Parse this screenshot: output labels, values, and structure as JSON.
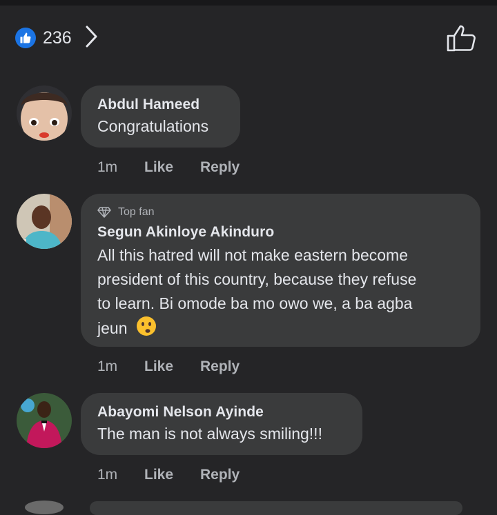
{
  "reactions": {
    "count": "236",
    "icon": "like-badge-icon"
  },
  "comments": [
    {
      "name": "Abdul Hameed",
      "text": "Congratulations",
      "time": "1m",
      "like": "Like",
      "reply": "Reply"
    },
    {
      "badge": "Top fan",
      "name": "Segun Akinloye Akinduro",
      "lines": [
        "All this hatred will not make eastern become",
        "president of this country, because they refuse",
        "to learn. Bi omode ba mo owo we, a ba agba",
        "jeun"
      ],
      "time": "1m",
      "like": "Like",
      "reply": "Reply"
    },
    {
      "name": "Abayomi Nelson Ayinde",
      "text": "The man is not always smiling!!!",
      "time": "1m",
      "like": "Like",
      "reply": "Reply"
    }
  ],
  "colors": {
    "background": "#252527",
    "bubble": "#3a3b3c",
    "accent": "#1b74e4",
    "muted": "#b0b3b8"
  }
}
